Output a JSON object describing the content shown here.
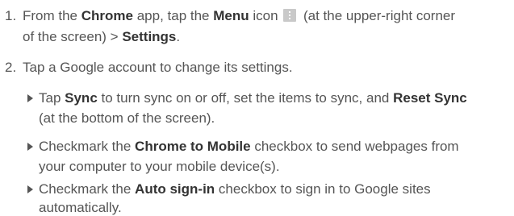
{
  "steps": [
    {
      "number": "1.",
      "l1_a": "From the ",
      "l1_app": "Chrome",
      "l1_b": " app, tap the ",
      "l1_menu": "Menu",
      "l1_c": " icon ",
      "l1_d": " (at the upper-right corner",
      "l2_a": "of the screen) > ",
      "l2_settings": "Settings",
      "l2_b": "."
    },
    {
      "number": "2.",
      "text": "Tap a Google account to change its settings."
    }
  ],
  "bullets": [
    {
      "l1_a": "Tap ",
      "l1_sync": "Sync",
      "l1_b": " to turn sync on or off, set the items to sync, and ",
      "l1_reset": "Reset Sync",
      "l2": "(at the bottom of the screen)."
    },
    {
      "l1_a": "Checkmark the ",
      "l1_b_bold": "Chrome to Mobile",
      "l1_c": " checkbox to send webpages from",
      "l2": "your computer to your mobile device(s)."
    },
    {
      "l1_a": "Checkmark the ",
      "l1_b_bold": "Auto sign-in",
      "l1_c": " checkbox to sign in to Google sites",
      "l2": "automatically."
    }
  ],
  "icons": {
    "menu": "vertical-dots-menu-icon"
  }
}
